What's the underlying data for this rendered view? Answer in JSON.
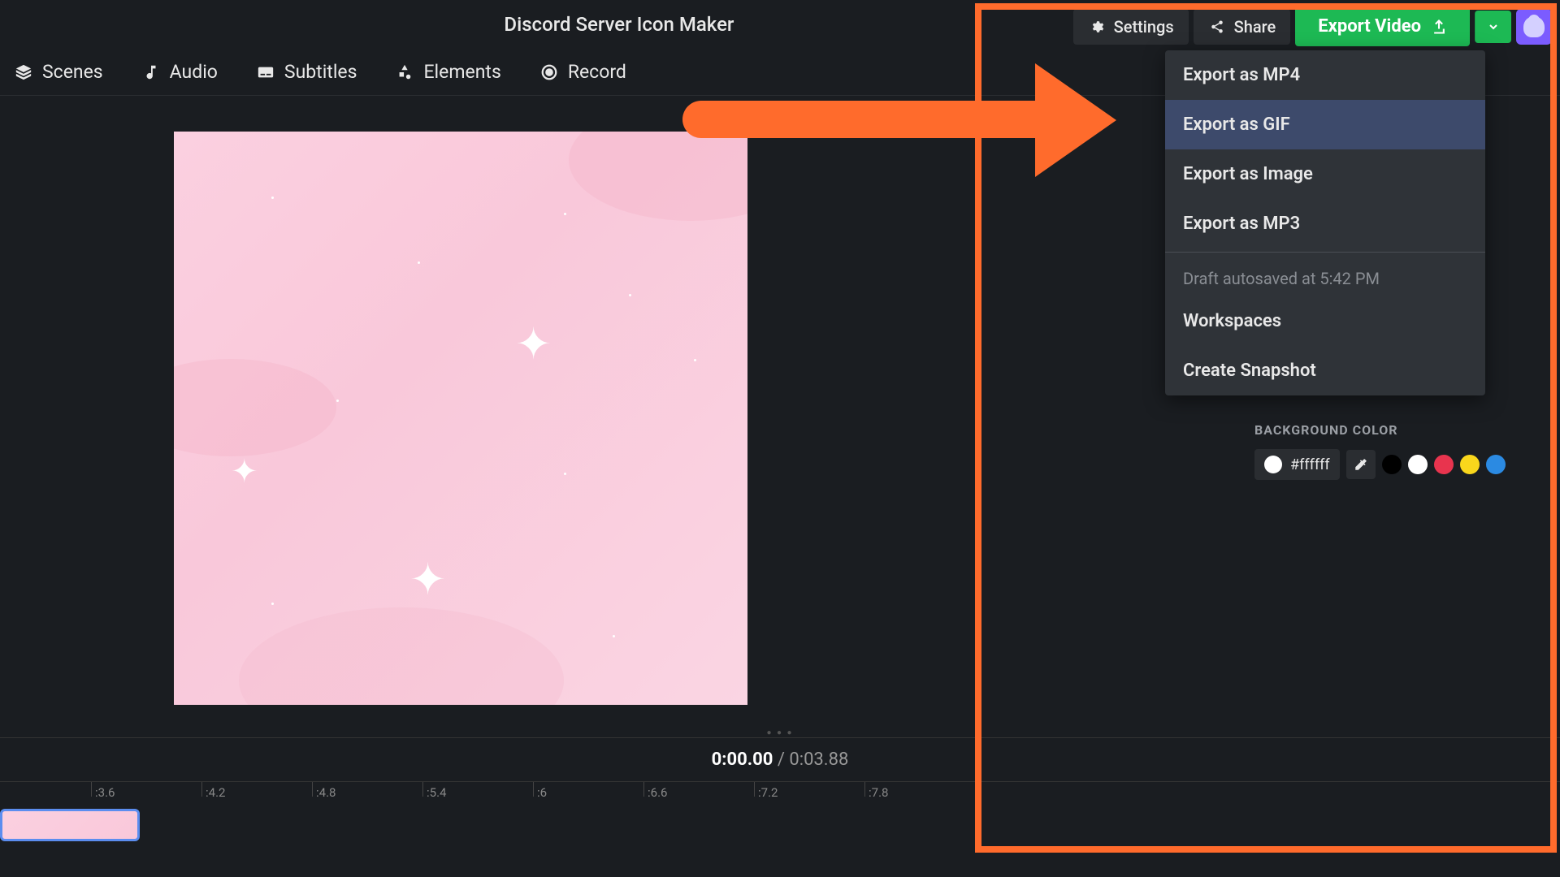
{
  "title": "Discord Server Icon Maker",
  "header": {
    "settings": "Settings",
    "share": "Share",
    "export": "Export Video"
  },
  "toolbar": {
    "scenes": "Scenes",
    "audio": "Audio",
    "subtitles": "Subtitles",
    "elements": "Elements",
    "record": "Record"
  },
  "dropdown": {
    "mp4": "Export as MP4",
    "gif": "Export as GIF",
    "image": "Export as Image",
    "mp3": "Export as MP3",
    "autosave": "Draft autosaved at 5:42 PM",
    "workspaces": "Workspaces",
    "snapshot": "Create Snapshot"
  },
  "timeline": {
    "current": "0:00.00",
    "separator": " / ",
    "total": "0:03.88",
    "ticks": [
      ":3.6",
      ":4.2",
      ":4.8",
      ":5.4",
      ":6",
      ":6.6",
      ":7.2",
      ":7.8"
    ]
  },
  "panel": {
    "bg_label": "BACKGROUND COLOR",
    "hex": "#ffffff",
    "swatches": [
      "#000000",
      "#ffffff",
      "#e8344e",
      "#f9d71c",
      "#2b8ae2"
    ]
  }
}
